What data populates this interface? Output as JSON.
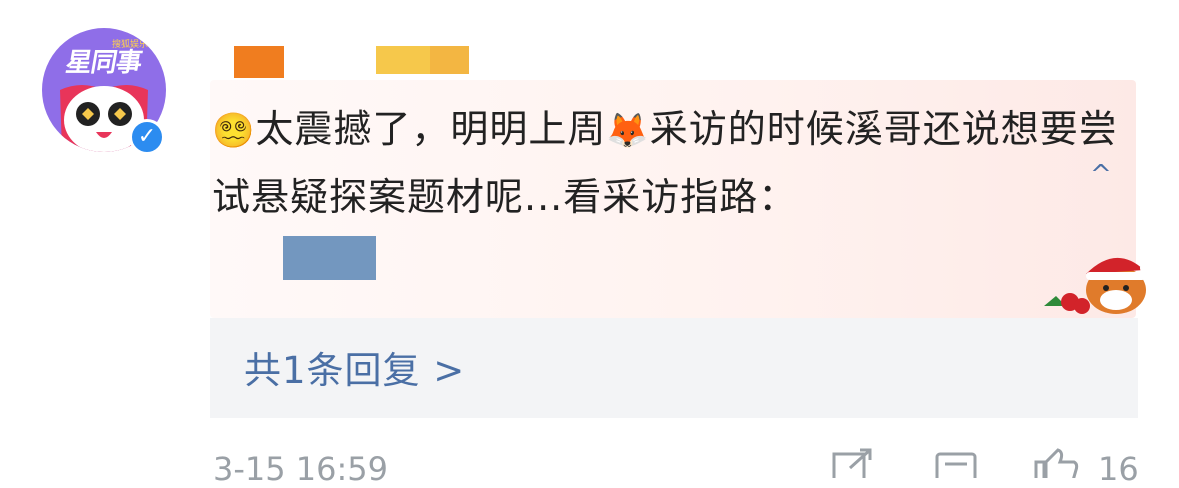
{
  "avatar": {
    "text": "星同事",
    "tag": "搜狐娱乐"
  },
  "comment": {
    "text_part1": "太震撼了，明明上周",
    "text_part2": "采访的时候溪哥还说想要尝试悬疑探案题材呢...看采访指路：",
    "emoji_start": "😵‍💫",
    "emoji_fox": "🦊",
    "collapse_icon": "^"
  },
  "replies": {
    "label": "共1条回复 >"
  },
  "footer": {
    "time": "3-15 16:59",
    "likes": "16"
  },
  "colors": {
    "link": "#4a6fa5",
    "bubble": "#fff2ef",
    "reply_bg": "#f3f4f6",
    "verify": "#2c8cf0"
  }
}
